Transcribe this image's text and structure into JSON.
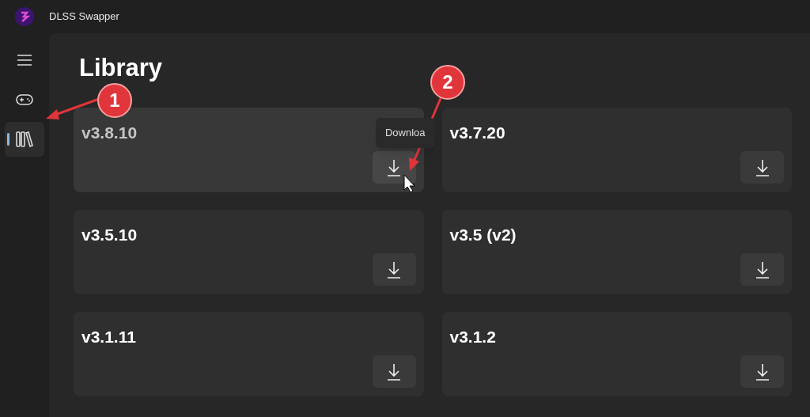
{
  "window": {
    "title": "DLSS Swapper"
  },
  "nav": [
    {
      "kind": "menu",
      "selected": false
    },
    {
      "kind": "games",
      "selected": false
    },
    {
      "kind": "library",
      "selected": true
    }
  ],
  "page": {
    "title": "Library"
  },
  "cards": [
    {
      "version": "v3.8.10",
      "hovered": true,
      "tooltip": "Downloa"
    },
    {
      "version": "v3.7.20",
      "hovered": false
    },
    {
      "version": "v3.5.10",
      "hovered": false
    },
    {
      "version": "v3.5 (v2)",
      "hovered": false
    },
    {
      "version": "v3.1.11",
      "hovered": false
    },
    {
      "version": "v3.1.2",
      "hovered": false
    }
  ],
  "callouts": [
    {
      "number": "1"
    },
    {
      "number": "2"
    }
  ]
}
